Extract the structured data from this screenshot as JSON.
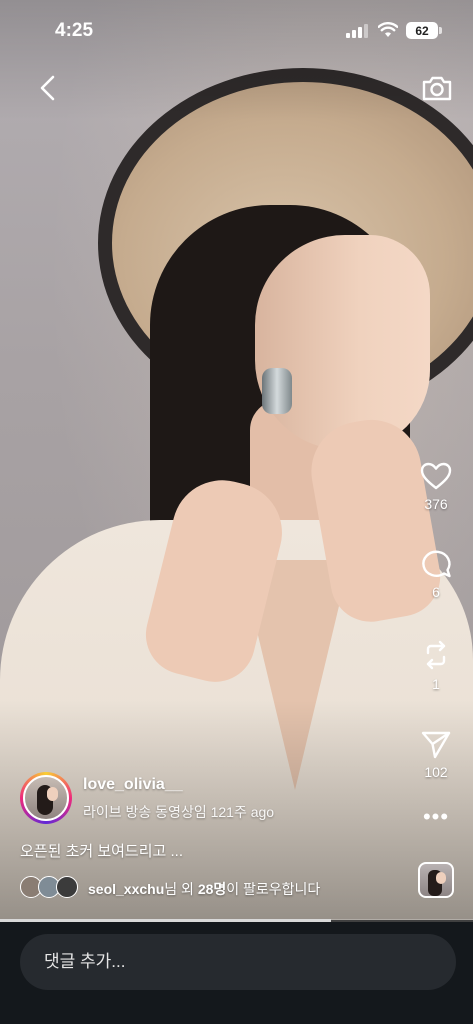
{
  "status_bar": {
    "time": "4:25",
    "battery": "62"
  },
  "stream": {
    "creator": {
      "username": "love_olivia__",
      "subtitle": "라이브 방송 동영상임 121주 ago"
    },
    "caption": "오픈된 초커 보여드리고 ...",
    "followers": {
      "name": "seol_xxchu",
      "middle": "님 외 ",
      "count": "28명",
      "suffix": "이 팔로우합니다"
    },
    "progress": 0.7
  },
  "actions": {
    "likes": "376",
    "comments": "6",
    "reposts": "1",
    "shares": "102"
  },
  "comment_box": {
    "placeholder": "댓글 추가..."
  },
  "icons": {
    "back": "chevron-left-icon",
    "camera": "camera-icon",
    "like": "heart-icon",
    "comment": "comment-icon",
    "repost": "repost-icon",
    "share": "send-icon",
    "more": "more-icon"
  },
  "colors": {
    "bottom_bar": "#14181c",
    "input_bg": "#262a2f"
  }
}
